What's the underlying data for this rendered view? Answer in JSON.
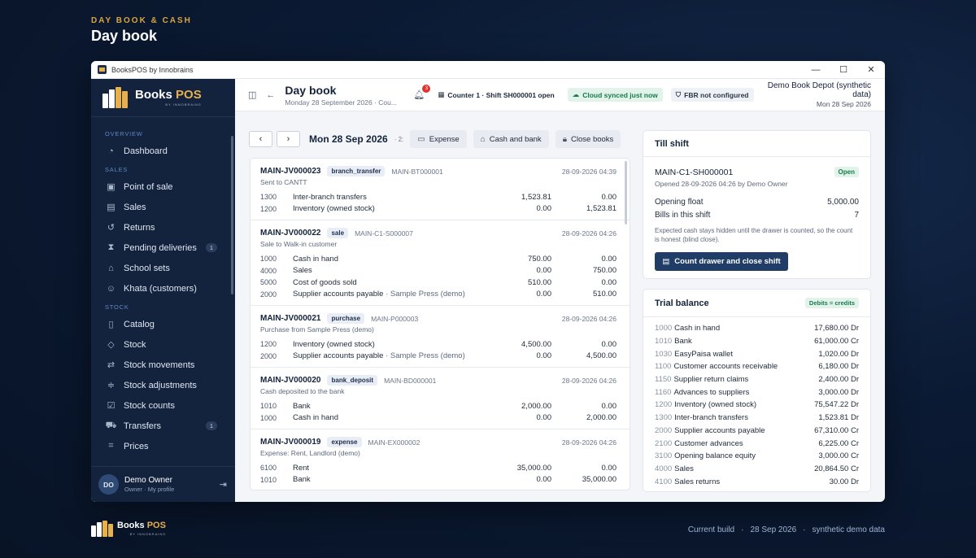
{
  "hero": {
    "kicker": "DAY BOOK & CASH",
    "title": "Day book"
  },
  "window": {
    "title": "BooksPOS by Innobrains",
    "minimize": "—",
    "maximize": "☐",
    "close": "✕"
  },
  "brand": {
    "name_a": "Books ",
    "name_b": "POS",
    "sub": "BY INNOBRAINS"
  },
  "sidebar": {
    "sections": {
      "overview": "OVERVIEW",
      "sales": "SALES",
      "stock": "STOCK"
    },
    "items": {
      "dashboard": "Dashboard",
      "pos": "Point of sale",
      "sales": "Sales",
      "returns": "Returns",
      "pending": "Pending deliveries",
      "pending_badge": "1",
      "school": "School sets",
      "khata": "Khata (customers)",
      "catalog": "Catalog",
      "stock": "Stock",
      "movements": "Stock movements",
      "adjustments": "Stock adjustments",
      "counts": "Stock counts",
      "transfers": "Transfers",
      "transfers_badge": "1",
      "prices": "Prices"
    },
    "user": {
      "initials": "DO",
      "name": "Demo Owner",
      "role": "Owner · My profile"
    }
  },
  "topbar": {
    "title": "Day book",
    "subtitle": "Monday 28 September 2026 · Cou...",
    "bell_count": "3",
    "shift": "Counter 1 · Shift SH000001 open",
    "sync": "Cloud synced just now",
    "fbr": "FBR not configured",
    "store_name": "Demo Book Depot (synthetic data)",
    "store_date": "Mon 28 Sep 2026"
  },
  "toolbar": {
    "prev": "‹",
    "next": "›",
    "date": "Mon 28 Sep 2026",
    "extra": "· 2:",
    "expense": "Expense",
    "cash_bank": "Cash and bank",
    "close_books": "Close books"
  },
  "entries": [
    {
      "id": "MAIN-JV000023",
      "tag": "branch_transfer",
      "ref": "MAIN-BT000001",
      "ts": "28-09-2026 04:39",
      "memo": "Sent to CANTT",
      "lines": [
        {
          "code": "1300",
          "acct": "Inter-branch transfers",
          "note": "",
          "dr": "1,523.81",
          "cr": "0.00"
        },
        {
          "code": "1200",
          "acct": "Inventory (owned stock)",
          "note": "",
          "dr": "0.00",
          "cr": "1,523.81"
        }
      ]
    },
    {
      "id": "MAIN-JV000022",
      "tag": "sale",
      "ref": "MAIN-C1-S000007",
      "ts": "28-09-2026 04:26",
      "memo": "Sale to Walk-in customer",
      "lines": [
        {
          "code": "1000",
          "acct": "Cash in hand",
          "note": "",
          "dr": "750.00",
          "cr": "0.00"
        },
        {
          "code": "4000",
          "acct": "Sales",
          "note": "",
          "dr": "0.00",
          "cr": "750.00"
        },
        {
          "code": "5000",
          "acct": "Cost of goods sold",
          "note": "",
          "dr": "510.00",
          "cr": "0.00"
        },
        {
          "code": "2000",
          "acct": "Supplier accounts payable",
          "note": " · Sample Press (demo)",
          "dr": "0.00",
          "cr": "510.00"
        }
      ]
    },
    {
      "id": "MAIN-JV000021",
      "tag": "purchase",
      "ref": "MAIN-P000003",
      "ts": "28-09-2026 04:26",
      "memo": "Purchase from Sample Press (demo)",
      "lines": [
        {
          "code": "1200",
          "acct": "Inventory (owned stock)",
          "note": "",
          "dr": "4,500.00",
          "cr": "0.00"
        },
        {
          "code": "2000",
          "acct": "Supplier accounts payable",
          "note": " · Sample Press (demo)",
          "dr": "0.00",
          "cr": "4,500.00"
        }
      ]
    },
    {
      "id": "MAIN-JV000020",
      "tag": "bank_deposit",
      "ref": "MAIN-BD000001",
      "ts": "28-09-2026 04:26",
      "memo": "Cash deposited to the bank",
      "lines": [
        {
          "code": "1010",
          "acct": "Bank",
          "note": "",
          "dr": "2,000.00",
          "cr": "0.00"
        },
        {
          "code": "1000",
          "acct": "Cash in hand",
          "note": "",
          "dr": "0.00",
          "cr": "2,000.00"
        }
      ]
    },
    {
      "id": "MAIN-JV000019",
      "tag": "expense",
      "ref": "MAIN-EX000002",
      "ts": "28-09-2026 04:26",
      "memo": "Expense: Rent, Landlord (demo)",
      "lines": [
        {
          "code": "6100",
          "acct": "Rent",
          "note": "",
          "dr": "35,000.00",
          "cr": "0.00"
        },
        {
          "code": "1010",
          "acct": "Bank",
          "note": "",
          "dr": "0.00",
          "cr": "35,000.00"
        }
      ]
    }
  ],
  "till": {
    "title": "Till shift",
    "shift_id": "MAIN-C1-SH000001",
    "status": "Open",
    "opened": "Opened 28-09-2026 04:26 by Demo Owner",
    "float_label": "Opening float",
    "float_value": "5,000.00",
    "bills_label": "Bills in this shift",
    "bills_value": "7",
    "hint": "Expected cash stays hidden until the drawer is counted, so the count is honest (blind close).",
    "button": "Count drawer and close shift"
  },
  "trial": {
    "title": "Trial balance",
    "status": "Debits = credits",
    "rows": [
      {
        "code": "1000",
        "name": "Cash in hand",
        "amount": "17,680.00 Dr"
      },
      {
        "code": "1010",
        "name": "Bank",
        "amount": "61,000.00 Cr"
      },
      {
        "code": "1030",
        "name": "EasyPaisa wallet",
        "amount": "1,020.00 Dr"
      },
      {
        "code": "1100",
        "name": "Customer accounts receivable",
        "amount": "6,180.00 Dr"
      },
      {
        "code": "1150",
        "name": "Supplier return claims",
        "amount": "2,400.00 Dr"
      },
      {
        "code": "1160",
        "name": "Advances to suppliers",
        "amount": "3,000.00 Dr"
      },
      {
        "code": "1200",
        "name": "Inventory (owned stock)",
        "amount": "75,547.22 Dr"
      },
      {
        "code": "1300",
        "name": "Inter-branch transfers",
        "amount": "1,523.81 Dr"
      },
      {
        "code": "2000",
        "name": "Supplier accounts payable",
        "amount": "67,310.00 Cr"
      },
      {
        "code": "2100",
        "name": "Customer advances",
        "amount": "6,225.00 Cr"
      },
      {
        "code": "3100",
        "name": "Opening balance equity",
        "amount": "3,000.00 Cr"
      },
      {
        "code": "4000",
        "name": "Sales",
        "amount": "20,864.50 Cr"
      },
      {
        "code": "4100",
        "name": "Sales returns",
        "amount": "30.00 Dr"
      }
    ]
  },
  "footer": {
    "build": "Current build",
    "date": "28 Sep 2026",
    "data": "synthetic demo data",
    "sep": "·"
  },
  "colors": {
    "sidebar": "#13233d",
    "accent": "#e8b04a",
    "primary": "#1f3d66",
    "success": "#1a7a4c"
  }
}
